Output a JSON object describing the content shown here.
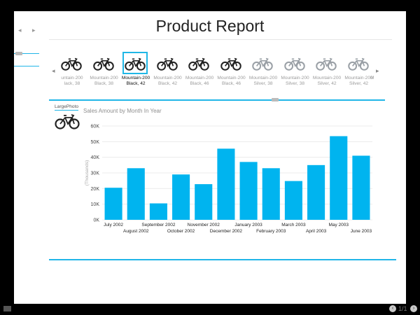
{
  "report": {
    "title": "Product Report",
    "nav": {
      "prev_icon": "◂",
      "next_icon": "▸"
    }
  },
  "slicer": {
    "prev_icon": "◂",
    "next_icon": "▸",
    "selected_index": 2,
    "items": [
      {
        "line1": "untain-200",
        "line2": "lack, 38",
        "color": "black"
      },
      {
        "line1": "Mountain-200",
        "line2": "Black, 38",
        "color": "black"
      },
      {
        "line1": "Mountain-200",
        "line2": "Black, 42",
        "color": "black"
      },
      {
        "line1": "Mountain-200",
        "line2": "Black, 42",
        "color": "black"
      },
      {
        "line1": "Mountain-200",
        "line2": "Black, 46",
        "color": "black"
      },
      {
        "line1": "Mountain-200",
        "line2": "Black, 46",
        "color": "black"
      },
      {
        "line1": "Mountain-200",
        "line2": "Silver, 38",
        "color": "silver"
      },
      {
        "line1": "Mountain-200",
        "line2": "Silver, 38",
        "color": "silver"
      },
      {
        "line1": "Mountain-200",
        "line2": "Silver, 42",
        "color": "silver"
      },
      {
        "line1": "Mountain-200",
        "line2": "Silver, 42",
        "color": "silver"
      }
    ],
    "overflow_mark": "M"
  },
  "photo_card": {
    "label": "LargePhoto"
  },
  "chart_data": {
    "type": "bar",
    "title": "Sales Amount by Month In Year",
    "ylabel": "(Thousands)",
    "xlabel": "",
    "ylim": [
      0,
      60000
    ],
    "yticks": [
      0,
      10000,
      20000,
      30000,
      40000,
      50000,
      60000
    ],
    "ytick_labels": [
      "0K",
      "10K",
      "20K",
      "30K",
      "40K",
      "50K",
      "60K"
    ],
    "grid": true,
    "bar_color": "#00b4ef",
    "categories": [
      "July 2002",
      "August 2002",
      "September 2002",
      "October 2002",
      "November 2002",
      "December 2002",
      "January 2003",
      "February 2003",
      "March 2003",
      "April 2003",
      "May 2003",
      "June 2003"
    ],
    "values": [
      20500,
      33000,
      10500,
      29000,
      22800,
      45500,
      37000,
      33000,
      24800,
      35000,
      53500,
      41000
    ]
  },
  "footer": {
    "page_count": "1/1",
    "prev_icon": "‹",
    "next_icon": "›"
  },
  "colors": {
    "accent": "#21b6e8",
    "bar": "#00b4ef",
    "background": "#000000"
  }
}
